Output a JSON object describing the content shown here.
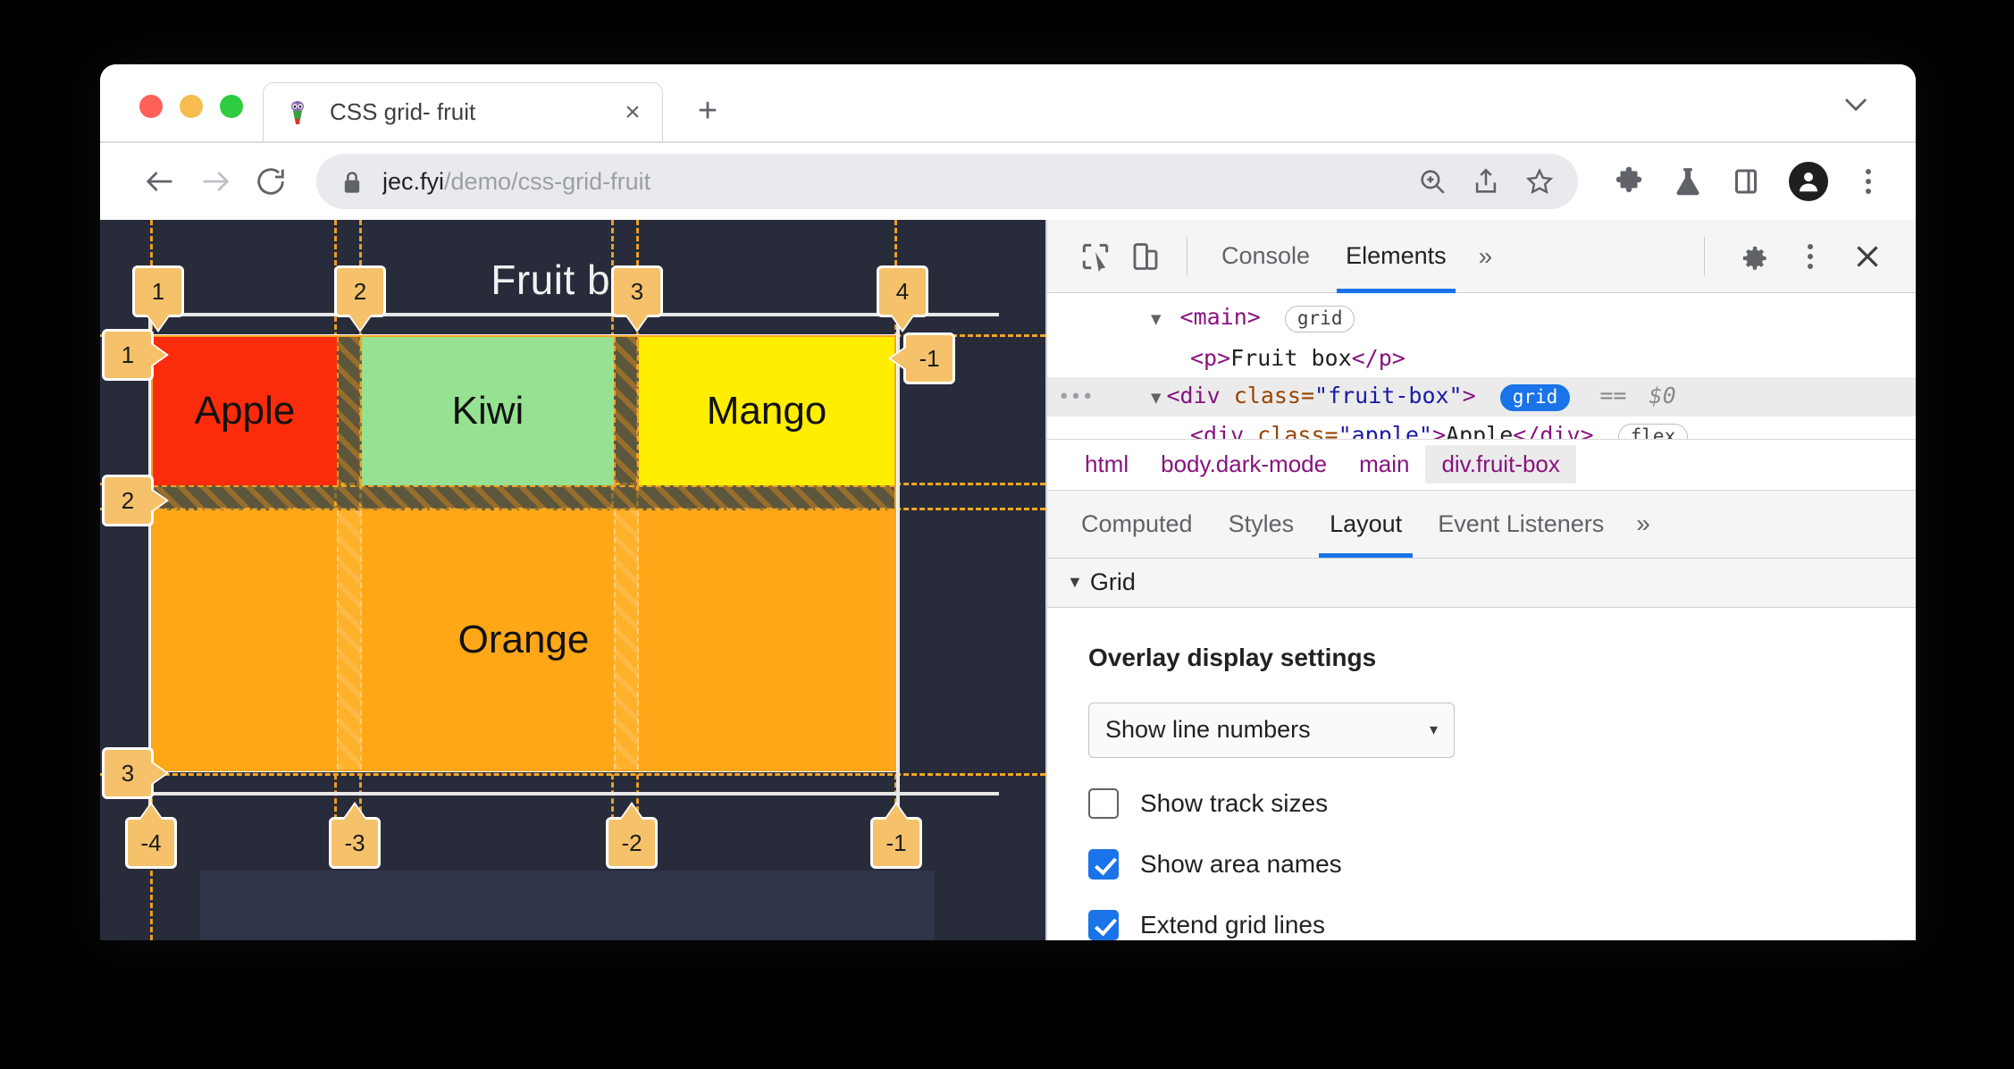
{
  "browser": {
    "tab": {
      "title": "CSS grid- fruit",
      "favicon": "fruit-favicon",
      "close_label": "×"
    },
    "new_tab_label": "+",
    "tabstrip_menu": "chevron-down-icon",
    "url": {
      "domain": "jec.fyi",
      "path": "/demo/css-grid-fruit",
      "full": "jec.fyi/demo/css-grid-fruit"
    },
    "toolbar_icons": [
      "back-arrow-icon",
      "forward-arrow-icon",
      "reload-icon",
      "lock-icon",
      "zoom-in-icon",
      "share-icon",
      "star-icon",
      "extensions-puzzle-icon",
      "experiments-flask-icon",
      "side-panel-icon",
      "profile-avatar-icon",
      "chrome-menu-kebab-icon"
    ]
  },
  "page": {
    "heading": "Fruit box",
    "cells": [
      {
        "name": "Apple",
        "color": "#FB2C0B"
      },
      {
        "name": "Kiwi",
        "color": "#96E292"
      },
      {
        "name": "Mango",
        "color": "#FFEE00"
      },
      {
        "name": "Orange",
        "color": "#FFA717"
      }
    ],
    "overlay": {
      "column_lines_top": [
        "1",
        "2",
        "3",
        "4"
      ],
      "column_lines_bottom": [
        "-4",
        "-3",
        "-2",
        "-1"
      ],
      "row_lines_left": [
        "1",
        "2",
        "3"
      ],
      "row_lines_right": [
        "-1"
      ],
      "badge_color": "#F5C26B",
      "line_color": "#F5A623"
    }
  },
  "devtools": {
    "toolbar": {
      "inspect_icon": "inspect-element-icon",
      "device_icon": "device-toolbar-icon",
      "settings_icon": "gear-icon",
      "more_icon": "more-vertical-icon",
      "close_icon": "close-icon"
    },
    "tabs": [
      {
        "label": "Console",
        "active": false
      },
      {
        "label": "Elements",
        "active": true
      }
    ],
    "tabs_overflow": "»",
    "dom": {
      "rows": [
        {
          "gutter": "",
          "caret": "▼",
          "indent": 1,
          "parts": [
            {
              "t": "tag",
              "v": "<main>"
            }
          ],
          "pill": "grid",
          "pill_style": "plain",
          "selected": false
        },
        {
          "gutter": "",
          "caret": "",
          "indent": 2,
          "parts": [
            {
              "t": "tag",
              "v": "<p>"
            },
            {
              "t": "text",
              "v": "Fruit box"
            },
            {
              "t": "tag",
              "v": "</p>"
            }
          ],
          "pill": "",
          "pill_style": "",
          "selected": false
        },
        {
          "gutter": "•••",
          "caret": "▼",
          "indent": 1,
          "parts": [
            {
              "t": "tag",
              "v": "<div "
            },
            {
              "t": "attrname",
              "v": "class="
            },
            {
              "t": "attrval",
              "v": "\"fruit-box\""
            },
            {
              "t": "tag",
              "v": ">"
            }
          ],
          "pill": "grid",
          "pill_style": "blue",
          "equals": "==",
          "dollar": "$0",
          "selected": true
        },
        {
          "gutter": "",
          "caret": "",
          "indent": 2,
          "parts": [
            {
              "t": "tag",
              "v": "<div "
            },
            {
              "t": "attrname",
              "v": "class="
            },
            {
              "t": "attrval",
              "v": "\"apple\""
            },
            {
              "t": "tag",
              "v": ">"
            },
            {
              "t": "text",
              "v": "Apple"
            },
            {
              "t": "tag",
              "v": "</div>"
            }
          ],
          "pill": "flex",
          "pill_style": "plain",
          "selected": false
        }
      ]
    },
    "breadcrumb": [
      "html",
      "body.dark-mode",
      "main",
      "div.fruit-box"
    ],
    "breadcrumb_active_index": 3,
    "subtabs": [
      {
        "label": "Computed",
        "active": false
      },
      {
        "label": "Styles",
        "active": false
      },
      {
        "label": "Layout",
        "active": true
      },
      {
        "label": "Event Listeners",
        "active": false
      }
    ],
    "subtabs_overflow": "»",
    "grid_section": {
      "section_label": "Grid",
      "caret": "▼",
      "settings_title": "Overlay display settings",
      "select": {
        "value": "Show line numbers",
        "arrow": "▾"
      },
      "checkboxes": [
        {
          "label": "Show track sizes",
          "checked": false
        },
        {
          "label": "Show area names",
          "checked": true
        },
        {
          "label": "Extend grid lines",
          "checked": true
        }
      ]
    }
  }
}
